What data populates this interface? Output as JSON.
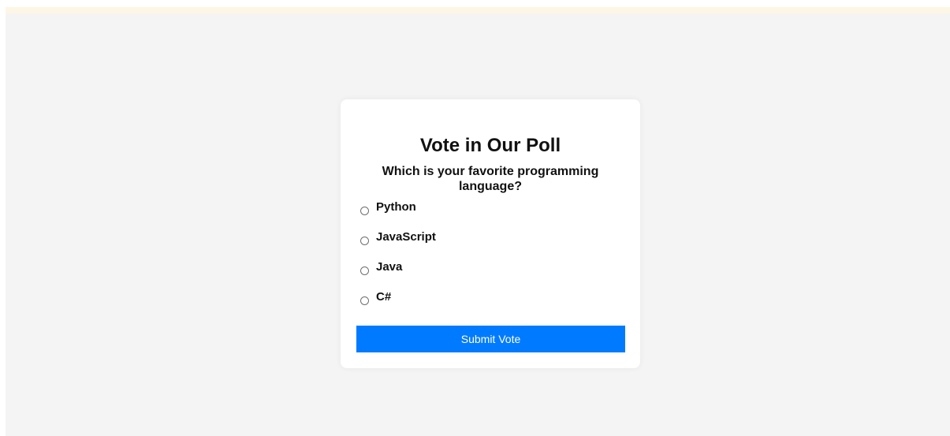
{
  "poll": {
    "title": "Vote in Our Poll",
    "question": "Which is your favorite programming language?",
    "options": [
      {
        "label": "Python",
        "selected": false
      },
      {
        "label": "JavaScript",
        "selected": false
      },
      {
        "label": "Java",
        "selected": false
      },
      {
        "label": "C#",
        "selected": false
      }
    ],
    "submit_label": "Submit Vote"
  },
  "colors": {
    "background": "#f4f4f4",
    "top_strip": "#fdf6e6",
    "card": "#ffffff",
    "button": "#007bff",
    "button_text": "#ffffff"
  }
}
